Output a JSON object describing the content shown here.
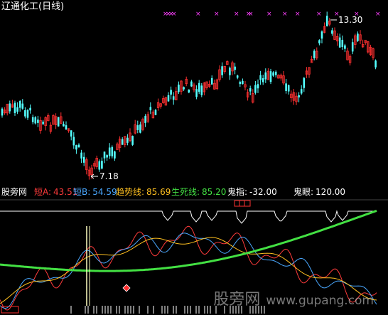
{
  "title": "辽通化工(日线)",
  "price_labels": {
    "high": "13.30",
    "low": "7.18"
  },
  "indicator_bar": {
    "name": "股旁网",
    "items": [
      {
        "label": "短A:",
        "value": "43.51",
        "color": "#ff3b3b"
      },
      {
        "label": "短B:",
        "value": "54.59",
        "color": "#4aa8ff"
      },
      {
        "label": "趋势线:",
        "value": "85.69",
        "color": "#ffc020"
      },
      {
        "label": "生死线:",
        "value": "85.20",
        "color": "#43e043"
      },
      {
        "label": "鬼指:",
        "value": "-32.00",
        "color": "#ffffff"
      },
      {
        "label": "鬼眼:",
        "value": "120.00",
        "color": "#ffffff"
      }
    ]
  },
  "watermark": {
    "text": "股旁网",
    "url": "www.gupang.com"
  },
  "colors": {
    "up": "#ff3030",
    "down": "#54ffff",
    "magenta": "#ff40ff",
    "green": "#43e043"
  }
}
